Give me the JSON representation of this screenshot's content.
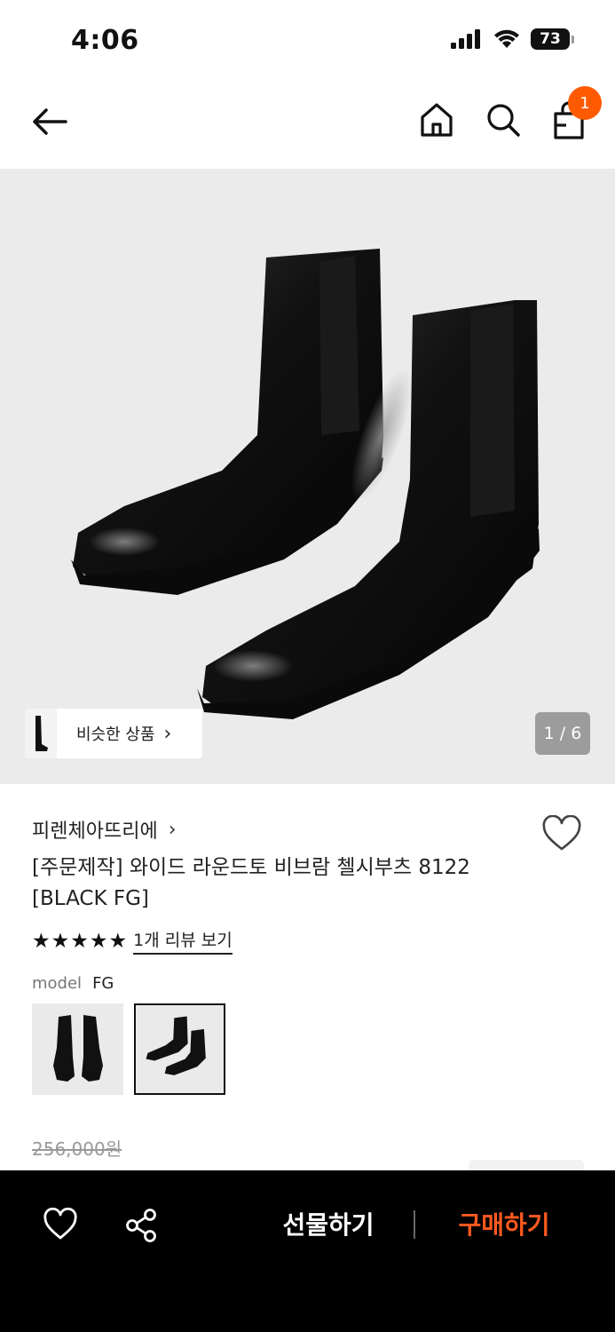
{
  "status_bar": {
    "time": "4:06",
    "battery": "73"
  },
  "header": {
    "cart_count": "1"
  },
  "gallery": {
    "similar_label": "비슷한 상품",
    "counter": "1 / 6"
  },
  "product": {
    "brand": "피렌체아뜨리에",
    "title": "[주문제작] 와이드 라운드토 비브람 첼시부츠 8122 [BLACK FG]",
    "stars": "★★★★★",
    "review_link": "1개 리뷰 보기",
    "option_label": "model",
    "option_value": "FG",
    "original_price": "256,000원"
  },
  "bottom_bar": {
    "gift_label": "선물하기",
    "buy_label": "구매하기"
  },
  "colors": {
    "accent": "#ff5a00",
    "buy": "#ff5a1f",
    "bar": "#000000"
  }
}
